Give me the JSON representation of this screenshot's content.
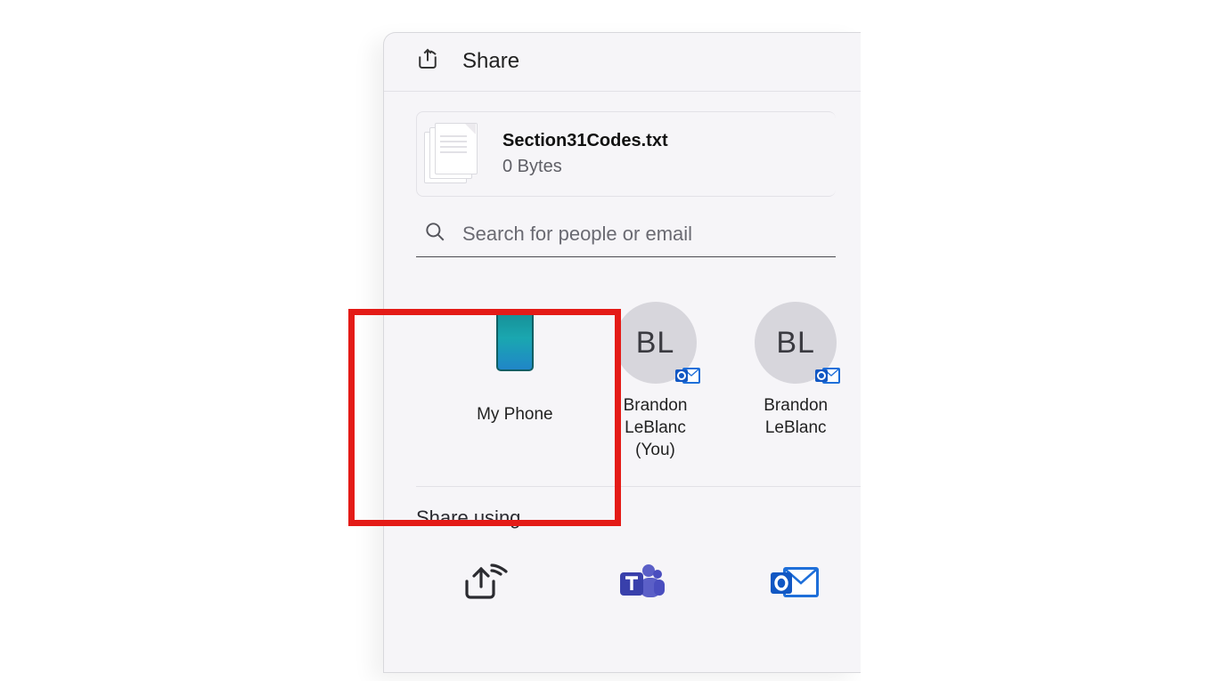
{
  "header": {
    "title": "Share"
  },
  "file": {
    "name": "Section31Codes.txt",
    "size": "0 Bytes"
  },
  "search": {
    "placeholder": "Search for people or email"
  },
  "targets": [
    {
      "label": "My Phone",
      "kind": "phone"
    },
    {
      "label": "Brandon LeBlanc (You)",
      "kind": "contact",
      "initials": "BL"
    },
    {
      "label": "Brandon LeBlanc",
      "kind": "contact",
      "initials": "BL"
    }
  ],
  "section": {
    "share_using": "Share using"
  },
  "apps": [
    {
      "name": "nearby-share"
    },
    {
      "name": "teams"
    },
    {
      "name": "outlook"
    }
  ]
}
